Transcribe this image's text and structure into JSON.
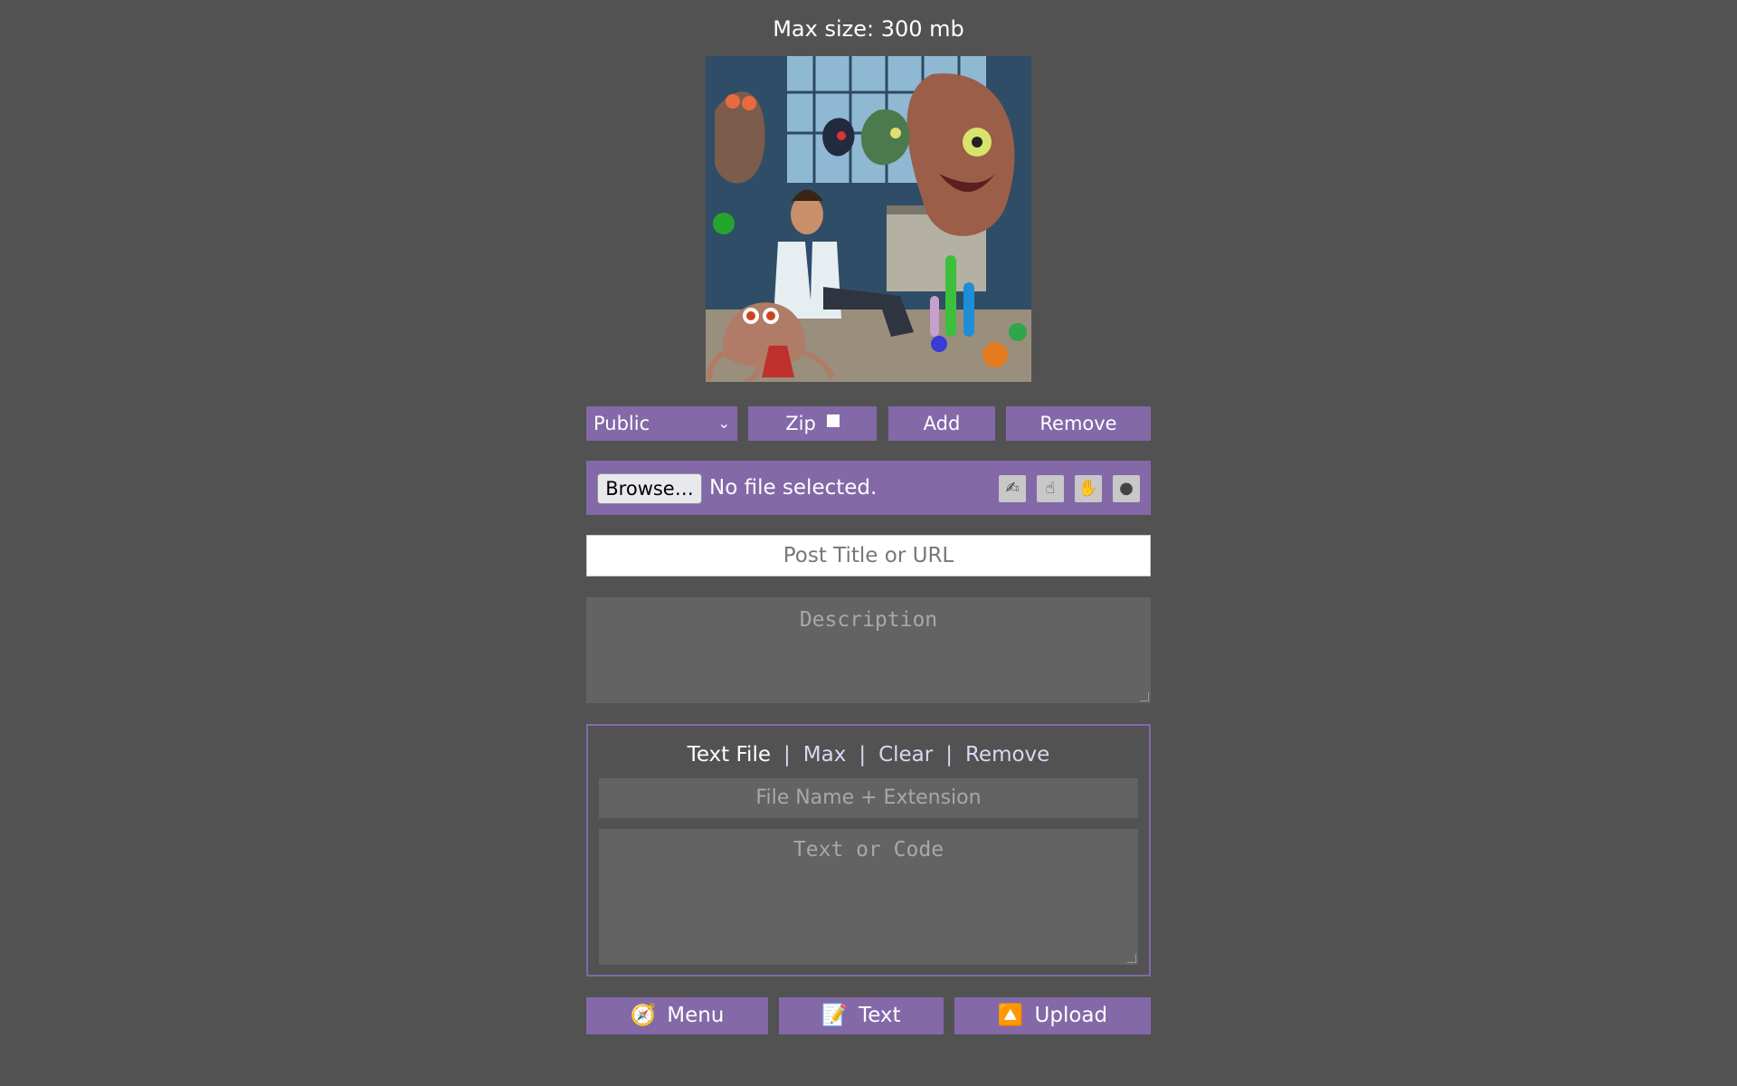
{
  "header": {
    "max_size": "Max size: 300 mb"
  },
  "preview": {
    "alt": "uploaded image preview"
  },
  "controls": {
    "privacy_selected": "Public",
    "zip_label": "Zip",
    "add_label": "Add",
    "remove_label": "Remove"
  },
  "file": {
    "browse_label": "Browse…",
    "status": "No file selected.",
    "tools": [
      "pen-icon",
      "hand-point-icon",
      "hand-stop-icon",
      "bomb-icon"
    ]
  },
  "post": {
    "title_placeholder": "Post Title or URL",
    "description_placeholder": "Description"
  },
  "text_file": {
    "tab_text_file": "Text File",
    "tab_max": "Max",
    "tab_clear": "Clear",
    "tab_remove": "Remove",
    "separator": "|",
    "name_placeholder": "File Name + Extension",
    "code_placeholder": "Text or Code"
  },
  "bottom": {
    "menu_icon": "🧭",
    "menu_label": "Menu",
    "text_icon": "📝",
    "text_label": "Text",
    "upload_icon": "🔼",
    "upload_label": "Upload"
  },
  "colors": {
    "background": "#525252",
    "accent": "#8369a8",
    "field": "#636363"
  }
}
